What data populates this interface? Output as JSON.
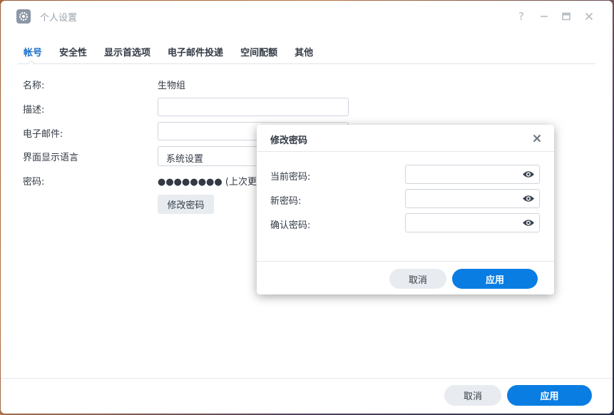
{
  "window": {
    "title": "个人设置",
    "help_icon": "?",
    "icons": [
      "gear-icon",
      "help-icon",
      "minimize-icon",
      "maximize-icon",
      "close-icon"
    ]
  },
  "tabs": [
    {
      "label": "帐号",
      "active": true
    },
    {
      "label": "安全性"
    },
    {
      "label": "显示首选项"
    },
    {
      "label": "电子邮件投递"
    },
    {
      "label": "空间配额"
    },
    {
      "label": "其他"
    }
  ],
  "form": {
    "name_label": "名称:",
    "name_value": "生物组",
    "desc_label": "描述:",
    "email_label": "电子邮件:",
    "lang_label": "界面显示语言",
    "lang_value": "系统设置",
    "password_label": "密码:",
    "password_value": "●●●●●●●● (上次更改：",
    "change_password_button": "修改密码"
  },
  "footer": {
    "cancel": "取消",
    "apply": "应用"
  },
  "dialog": {
    "title": "修改密码",
    "current_label": "当前密码:",
    "new_label": "新密码:",
    "confirm_label": "确认密码:",
    "cancel": "取消",
    "apply": "应用"
  },
  "colors": {
    "accent": "#0a7de3",
    "active_tab": "#1b6fc8"
  }
}
